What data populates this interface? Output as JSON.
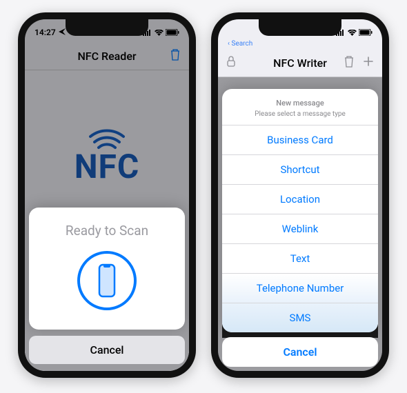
{
  "left": {
    "status_time": "14:27",
    "nav_title": "NFC Reader",
    "nfc_label": "NFC",
    "sheet_title": "Ready to Scan",
    "cancel_label": "Cancel"
  },
  "right": {
    "breadcrumb": "Search",
    "nav_title": "NFC Writer",
    "menu_title": "New message",
    "menu_subtitle": "Please select a message type",
    "options": [
      "Business Card",
      "Shortcut",
      "Location",
      "Weblink",
      "Text",
      "Telephone Number",
      "SMS"
    ],
    "cancel_label": "Cancel"
  }
}
